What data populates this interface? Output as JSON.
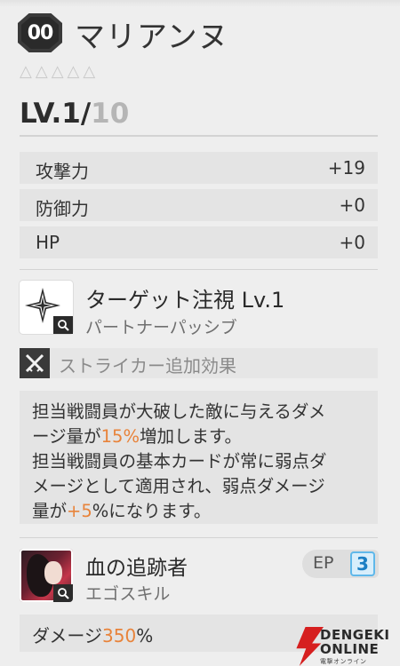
{
  "header": {
    "rank": "00",
    "name": "マリアンヌ",
    "stars": [
      "△",
      "△",
      "△",
      "△",
      "△"
    ],
    "level_prefix": "LV.1/",
    "level_max": "10"
  },
  "stats": [
    {
      "label": "攻撃力",
      "value": "+19"
    },
    {
      "label": "防御力",
      "value": "+0"
    },
    {
      "label": "HP",
      "value": "+0"
    }
  ],
  "skill": {
    "title": "ターゲット注視 Lv.1",
    "subtitle": "パートナーパッシブ",
    "striker_label": "ストライカー追加効果",
    "desc": {
      "l1": "担当戦闘員が大破した敵に与えるダメ",
      "l2a": "ージ量が",
      "l2b": "15%",
      "l2c": "増加します。",
      "l3": "担当戦闘員の基本カードが常に弱点ダ",
      "l4": "メージとして適用され、弱点ダメージ",
      "l5a": "量が",
      "l5b": "+5",
      "l5c": "%になります。"
    }
  },
  "ego": {
    "title": "血の追跡者",
    "subtitle": "エゴスキル",
    "ep_label": "EP",
    "ep_value": "3",
    "damage_label": "ダメージ",
    "damage_value": "350",
    "damage_unit": "%"
  },
  "watermark": {
    "line1": "DENGEKI",
    "line2": "ONLINE",
    "line3": "電撃オンライン"
  },
  "colors": {
    "highlight": "#e8833a",
    "ep_accent": "#5fb8ea",
    "brand_red": "#d61f1f"
  }
}
